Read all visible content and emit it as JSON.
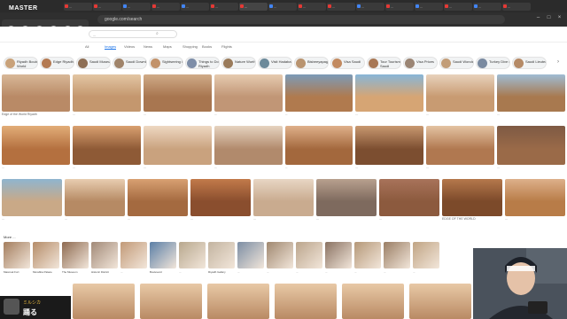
{
  "stream": {
    "logo": "MASTER",
    "chat_name": "ミルシカ",
    "chat_message": "踊る"
  },
  "browser": {
    "tabs": [
      {
        "label": "...",
        "color": "#e53935"
      },
      {
        "label": "...",
        "color": "#e53935"
      },
      {
        "label": "...",
        "color": "#4285f4"
      },
      {
        "label": "...",
        "color": "#e53935"
      },
      {
        "label": "...",
        "color": "#4285f4"
      },
      {
        "label": "...",
        "color": "#e53935"
      },
      {
        "label": "...",
        "color": "#e53935"
      },
      {
        "label": "...",
        "color": "#4285f4"
      },
      {
        "label": "...",
        "color": "#e53935"
      },
      {
        "label": "...",
        "color": "#e53935"
      },
      {
        "label": "...",
        "color": "#4285f4"
      },
      {
        "label": "...",
        "color": "#e53935"
      },
      {
        "label": "...",
        "color": "#4285f4"
      },
      {
        "label": "...",
        "color": "#e53935"
      },
      {
        "label": "...",
        "color": "#4285f4"
      },
      {
        "label": "...",
        "color": "#e53935"
      }
    ],
    "url": "google.com/search",
    "window_controls": [
      "–",
      "□",
      "×"
    ]
  },
  "search": {
    "query": "...",
    "filters": [
      "All",
      "Images",
      "Videos",
      "News",
      "Maps",
      "Shopping",
      "Books",
      "Flights"
    ],
    "active_filter": "Images"
  },
  "chips": [
    {
      "label": "Riyadh Boulevard World",
      "color": "#c9a27a"
    },
    {
      "label": "Edge Riyadh",
      "color": "#b47a52"
    },
    {
      "label": "Saudi Museum",
      "color": "#8e6f55"
    },
    {
      "label": "Saudi Downtown",
      "color": "#a0846a"
    },
    {
      "label": "Sightseeing in Saudi",
      "color": "#c2926a"
    },
    {
      "label": "Things to Do in Riyadh",
      "color": "#7e8ea8"
    },
    {
      "label": "Nature Worth Visiting",
      "color": "#9a7b5b"
    },
    {
      "label": "Visit Hadaba",
      "color": "#6d8a9a"
    },
    {
      "label": "Bisbeeyapagaki",
      "color": "#b99470"
    },
    {
      "label": "Visa Saudi",
      "color": "#c28a60"
    },
    {
      "label": "Tour Tourism in Saudi",
      "color": "#a87856"
    },
    {
      "label": "Visa Prices",
      "color": "#9b8574"
    },
    {
      "label": "Saudi Wonders",
      "color": "#c29d78"
    },
    {
      "label": "Turkey Dive Center",
      "color": "#7a8aa0"
    },
    {
      "label": "Saudi Lieutenant",
      "color": "#b58a66"
    }
  ],
  "images_row1": [
    {
      "caption": "Edge of the World Riyadh",
      "c1": "#b98a66",
      "c2": "#d8b898"
    },
    {
      "caption": "...",
      "c1": "#c4976e",
      "c2": "#e3c6a4"
    },
    {
      "caption": "...",
      "c1": "#a87650",
      "c2": "#d0ab88"
    },
    {
      "caption": "...",
      "c1": "#c19676",
      "c2": "#e6cbb0"
    },
    {
      "caption": "...",
      "c1": "#b07a4e",
      "c2": "#7c9bb8"
    },
    {
      "caption": "...",
      "c1": "#d6a574",
      "c2": "#88b6d8"
    },
    {
      "caption": "...",
      "c1": "#c89b72",
      "c2": "#e8d2bc"
    },
    {
      "caption": "...",
      "c1": "#a8794f",
      "c2": "#9fbcd4"
    }
  ],
  "images_row2": [
    {
      "caption": "...",
      "c1": "#b4703f",
      "c2": "#e2ad78"
    },
    {
      "caption": "...",
      "c1": "#8e5a36",
      "c2": "#d9a070"
    },
    {
      "caption": "...",
      "c1": "#c9a27e",
      "c2": "#eed8c2"
    },
    {
      "caption": "...",
      "c1": "#b18a6c",
      "c2": "#e6d3c0"
    },
    {
      "caption": "...",
      "c1": "#a3683d",
      "c2": "#dfb08a"
    },
    {
      "caption": "...",
      "c1": "#7c4e30",
      "c2": "#c89870"
    },
    {
      "caption": "...",
      "c1": "#b07850",
      "c2": "#e4c3a2"
    },
    {
      "caption": "...",
      "c1": "#9a6a48",
      "c2": "#7e5a44"
    }
  ],
  "images_row3": [
    {
      "caption": "...",
      "c1": "#c9a987",
      "c2": "#8fb5cf"
    },
    {
      "caption": "...",
      "c1": "#b68a64",
      "c2": "#e8cdb0"
    },
    {
      "caption": "...",
      "c1": "#a46a40",
      "c2": "#d8a072"
    },
    {
      "caption": "...",
      "c1": "#8a4e2e",
      "c2": "#c27a4a"
    },
    {
      "caption": "...",
      "c1": "#c9ab8f",
      "c2": "#e8d6c4"
    },
    {
      "caption": "...",
      "c1": "#7e6a5e",
      "c2": "#b8a08e"
    },
    {
      "caption": "...",
      "c1": "#8c5a3e",
      "c2": "#a8735a"
    },
    {
      "caption": "EDGE OF THE WORLD",
      "c1": "#7c4a2a",
      "c2": "#b5784c"
    },
    {
      "caption": "...",
      "c1": "#b87c48",
      "c2": "#ddb08a"
    }
  ],
  "related_section_title": "More ...",
  "related": [
    {
      "label": "Masmak Fort",
      "color": "#a47e5e"
    },
    {
      "label": "Murabba Palace",
      "color": "#b58c68"
    },
    {
      "label": "The Museum",
      "color": "#8e6a50"
    },
    {
      "label": "Historic District",
      "color": "#a28a78"
    },
    {
      "label": "...",
      "color": "#c29a78"
    },
    {
      "label": "Boulevard",
      "color": "#5b7fa6"
    },
    {
      "label": "...",
      "color": "#b8a88e"
    },
    {
      "label": "Riyadh Gallery",
      "color": "#c3b4a0"
    },
    {
      "label": "...",
      "color": "#7c8ea4"
    },
    {
      "label": "...",
      "color": "#a08870"
    },
    {
      "label": "...",
      "color": "#bba58c"
    },
    {
      "label": "...",
      "color": "#8a7262"
    },
    {
      "label": "...",
      "color": "#b59878"
    },
    {
      "label": "...",
      "color": "#9a7e64"
    },
    {
      "label": "...",
      "color": "#c0a484"
    }
  ]
}
